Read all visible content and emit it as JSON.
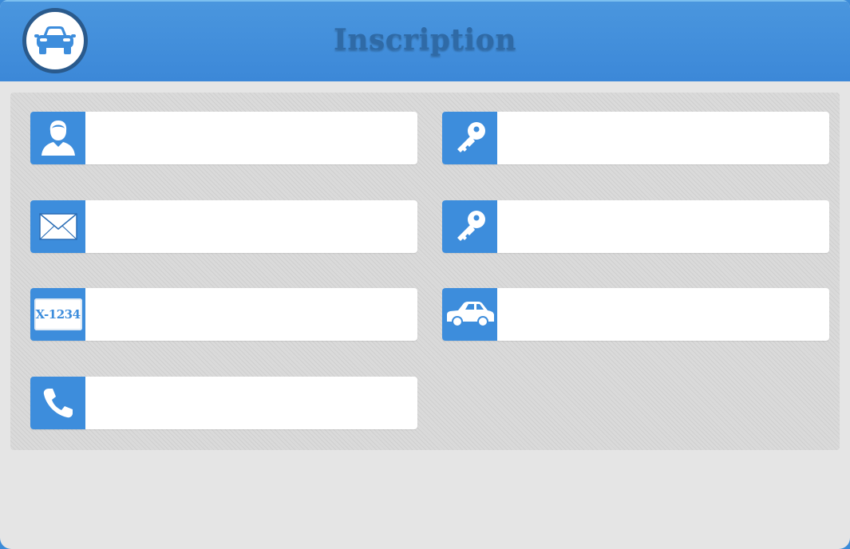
{
  "header": {
    "title": "Inscription",
    "logo_icon": "car-front-icon"
  },
  "form": {
    "fields": [
      {
        "id": "name",
        "icon": "user-icon",
        "value": "",
        "placeholder": ""
      },
      {
        "id": "email",
        "icon": "envelope-icon",
        "value": "",
        "placeholder": ""
      },
      {
        "id": "plate",
        "icon": "license-plate-icon",
        "value": "",
        "placeholder": "",
        "plate_text": "X-1234"
      },
      {
        "id": "phone",
        "icon": "phone-icon",
        "value": "",
        "placeholder": ""
      },
      {
        "id": "password",
        "icon": "key-icon",
        "value": "",
        "placeholder": ""
      },
      {
        "id": "password_confirm",
        "icon": "key-icon",
        "value": "",
        "placeholder": ""
      },
      {
        "id": "vehicle",
        "icon": "car-side-icon",
        "value": "",
        "placeholder": ""
      }
    ]
  },
  "colors": {
    "accent": "#3d8ddc",
    "header": "#3c88d8",
    "title": "#2f6aa6",
    "background": "#e5e5e5"
  }
}
